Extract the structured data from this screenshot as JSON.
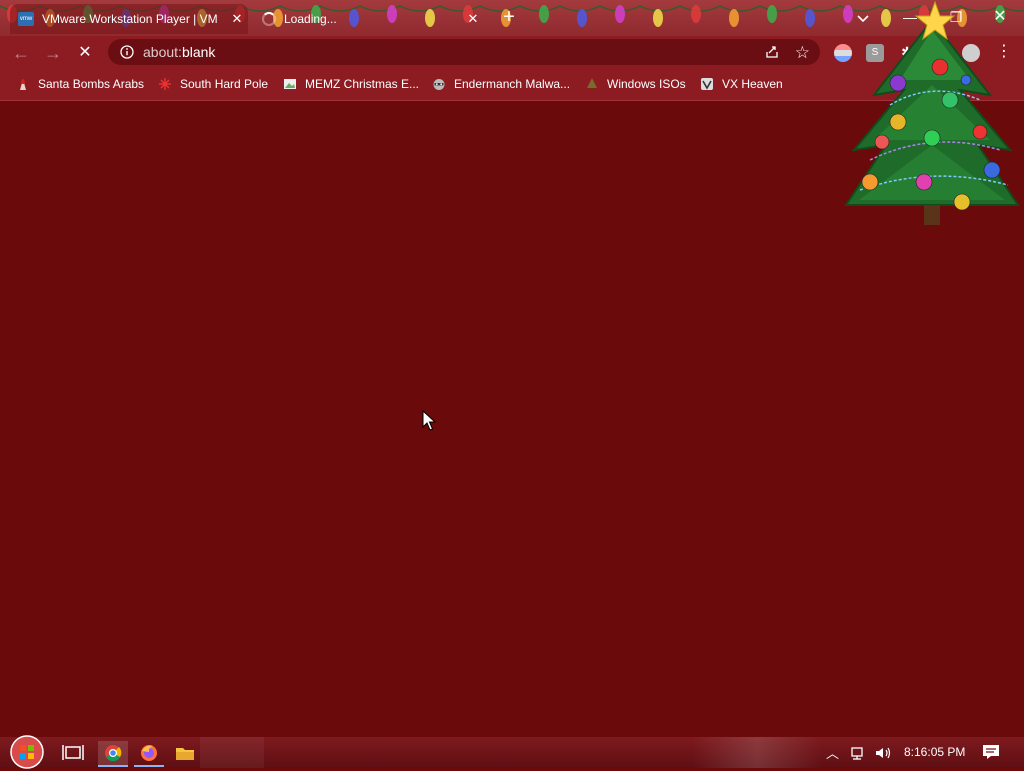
{
  "browser": {
    "tabs": [
      {
        "title": "VMware Workstation Player | VM",
        "active": true
      },
      {
        "title": "Loading...",
        "active": false
      }
    ],
    "omnibox": {
      "url_prefix": "about:",
      "url_rest": "blank"
    }
  },
  "bookmarks": [
    {
      "label": "Santa Bombs Arabs",
      "icon": "santa-icon"
    },
    {
      "label": "South Hard Pole",
      "icon": "snowflake-icon"
    },
    {
      "label": "MEMZ Christmas E...",
      "icon": "image-icon"
    },
    {
      "label": "Endermanch Malwa...",
      "icon": "raccoon-icon"
    },
    {
      "label": "Windows ISOs",
      "icon": "tree-icon"
    },
    {
      "label": "VX Heaven",
      "icon": "vx-icon"
    }
  ],
  "taskbar": {
    "clock": "8:16:05 PM"
  },
  "theme": {
    "tabstrip": "#a33a3e",
    "toolbar": "#8d1c22",
    "page": "#6b0a0a",
    "taskbar": "#7e1a1f"
  }
}
